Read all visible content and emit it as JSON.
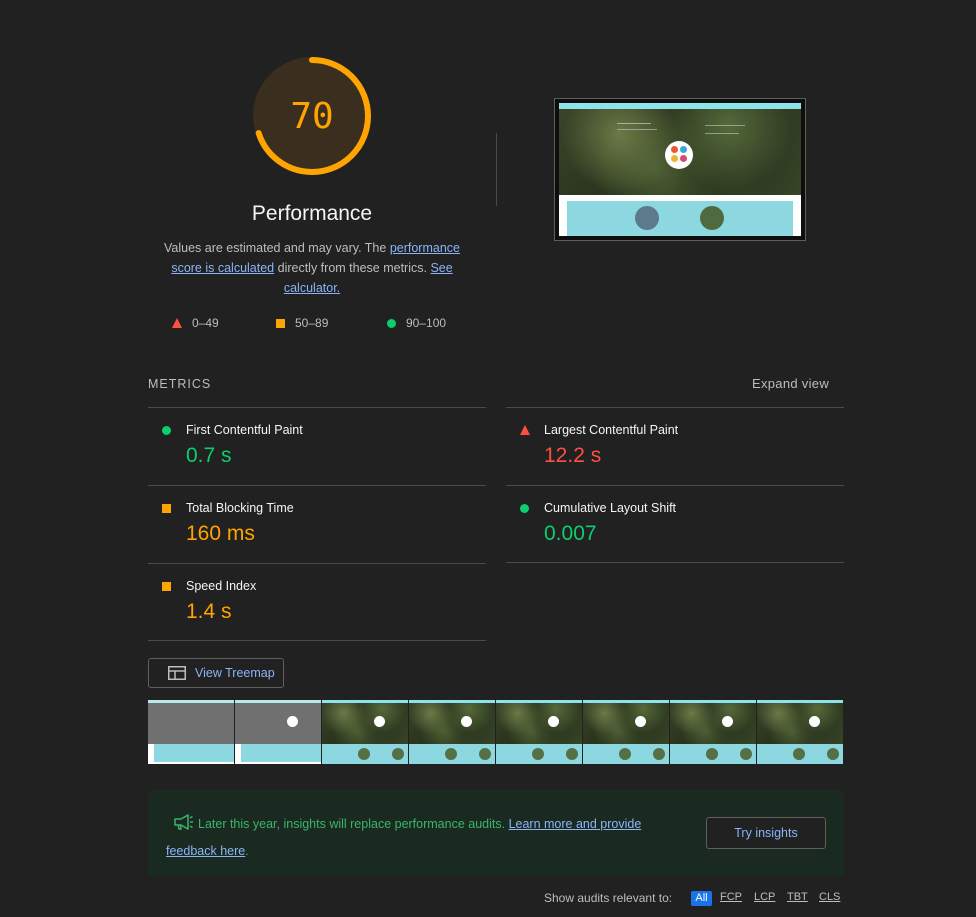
{
  "score": {
    "value": "70",
    "fraction": 0.7,
    "color": "#ffa400",
    "title": "Performance",
    "description": {
      "prefix": "Values are estimated and may vary. The ",
      "link1": "performance score is calculated",
      "middle": " directly from these metrics. ",
      "link2": "See calculator."
    }
  },
  "legend": [
    {
      "icon": "red-triangle-icon",
      "label": "0–49"
    },
    {
      "icon": "orange-square-icon",
      "label": "50–89"
    },
    {
      "icon": "green-circle-icon",
      "label": "90–100"
    }
  ],
  "metrics": {
    "header": "METRICS",
    "expand_label": "Expand view",
    "items": [
      {
        "label": "First Contentful Paint",
        "value": "0.7 s",
        "status": "good"
      },
      {
        "label": "Largest Contentful Paint",
        "value": "12.2 s",
        "status": "poor"
      },
      {
        "label": "Total Blocking Time",
        "value": "160 ms",
        "status": "average"
      },
      {
        "label": "Cumulative Layout Shift",
        "value": "0.007",
        "status": "good"
      },
      {
        "label": "Speed Index",
        "value": "1.4 s",
        "status": "average"
      }
    ]
  },
  "treemap_label": "View Treemap",
  "insights": {
    "text": "Later this year, insights will replace performance audits. ",
    "link": "Learn more and provide feedback here",
    "end": ".",
    "button": "Try insights"
  },
  "filter": {
    "label": "Show audits relevant to:",
    "chips": [
      "All",
      "FCP",
      "LCP",
      "TBT",
      "CLS"
    ]
  },
  "colors": {
    "good": "#0cce6b",
    "average": "#ffa400",
    "poor": "#ff4e42",
    "link": "#8ab4f8",
    "background": "#212121"
  }
}
